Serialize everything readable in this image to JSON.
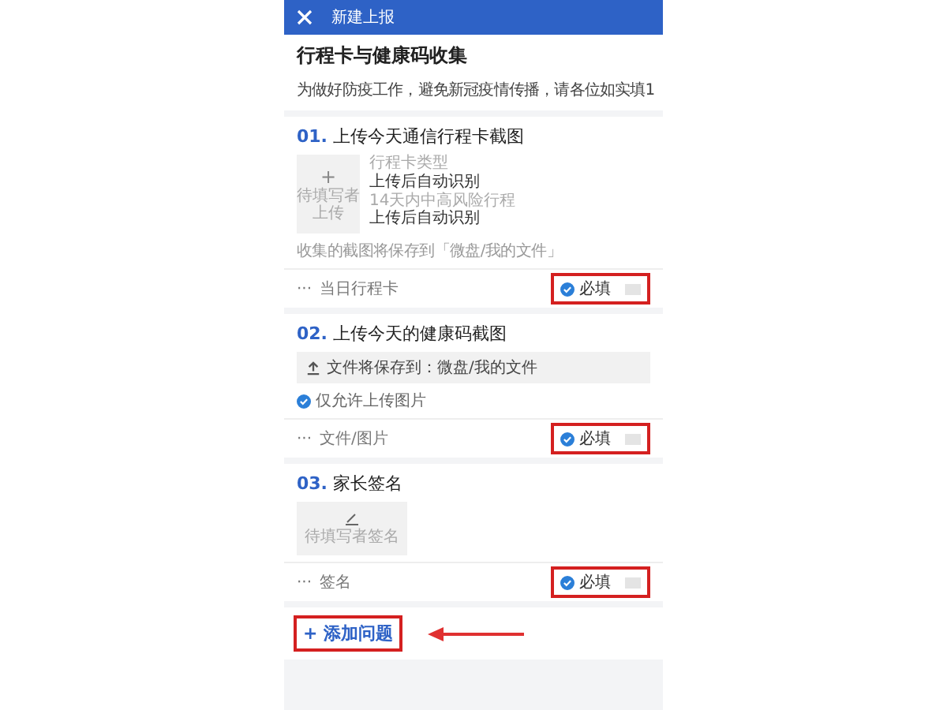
{
  "header": {
    "title": "新建上报"
  },
  "form": {
    "title": "行程卡与健康码收集",
    "description": "为做好防疫工作，避免新冠疫情传播，请各位如实填1"
  },
  "questions": [
    {
      "kind": "upload-card",
      "number": "01.",
      "title": "上传今天通信行程卡截图",
      "tile_plus": "+",
      "tile_text": "待填写者上传",
      "fields": [
        {
          "label": "行程卡类型",
          "value": "上传后自动识别"
        },
        {
          "label": "14天内中高风险行程",
          "value": "上传后自动识别"
        }
      ],
      "note": "收集的截图将保存到「微盘/我的文件」",
      "more": "···",
      "type_label": "当日行程卡",
      "required_label": "必填",
      "required": true,
      "highlighted": true
    },
    {
      "kind": "file",
      "number": "02.",
      "title": "上传今天的健康码截图",
      "save_path": "文件将保存到：微盘/我的文件",
      "option": {
        "label": "仅允许上传图片",
        "checked": true
      },
      "more": "···",
      "type_label": "文件/图片",
      "required_label": "必填",
      "required": true,
      "highlighted": true
    },
    {
      "kind": "signature",
      "number": "03.",
      "title": "家长签名",
      "placeholder": "待填写者签名",
      "more": "···",
      "type_label": "签名",
      "required_label": "必填",
      "required": true,
      "highlighted": true
    }
  ],
  "add_question": {
    "label": "+ 添加问题",
    "highlighted": true
  }
}
